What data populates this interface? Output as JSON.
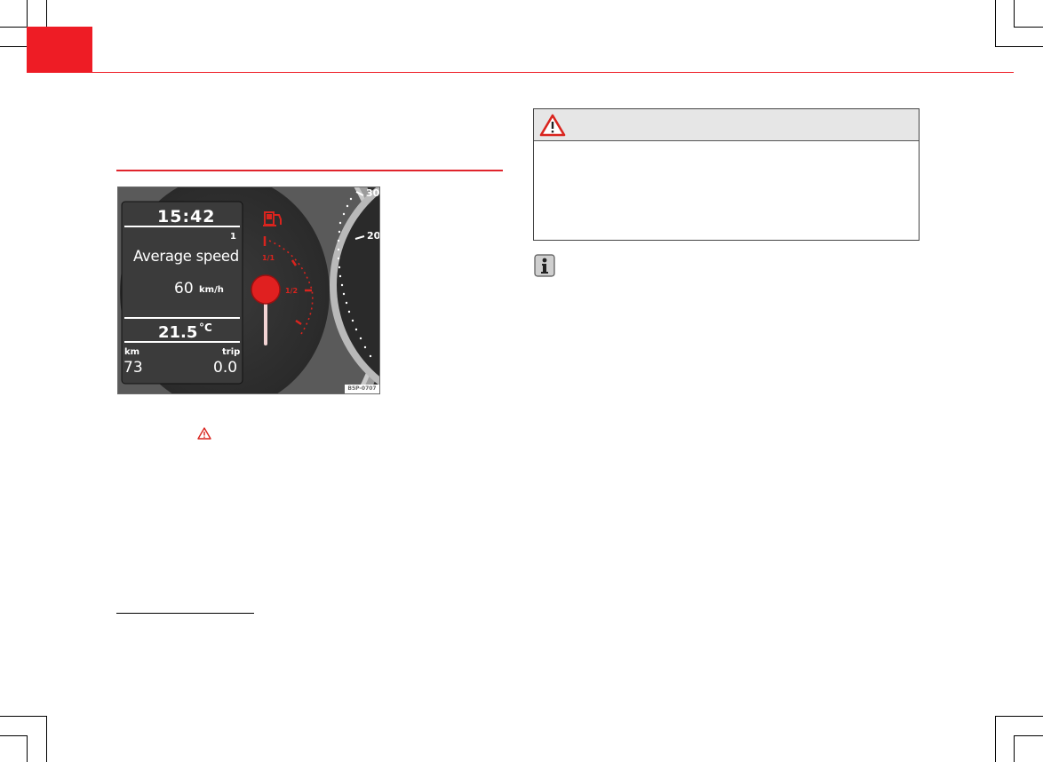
{
  "figure": {
    "code": "B5P-0707",
    "display": {
      "time": "15:42",
      "page_index": "1",
      "label": "Average speed",
      "speed_value": "60",
      "speed_unit": "km/h",
      "temperature_value": "21.5",
      "temperature_unit": "°C",
      "odometer_label": "km",
      "odometer_value": "73",
      "trip_label": "trip",
      "trip_value": "0.0"
    },
    "speedometer_marks": [
      "30",
      "20"
    ],
    "fuel_gauge_marks": [
      "1/1",
      "1/2"
    ]
  },
  "icons": {
    "inline_warning": "warning-triangle-icon",
    "box_warning": "warning-triangle-icon",
    "info": "info-icon",
    "fuel": "fuel-pump-icon"
  },
  "colors": {
    "accent_red": "#ee1c25",
    "warning_header_gray": "#e6e6e6",
    "display_background": "#3b3b3b"
  }
}
